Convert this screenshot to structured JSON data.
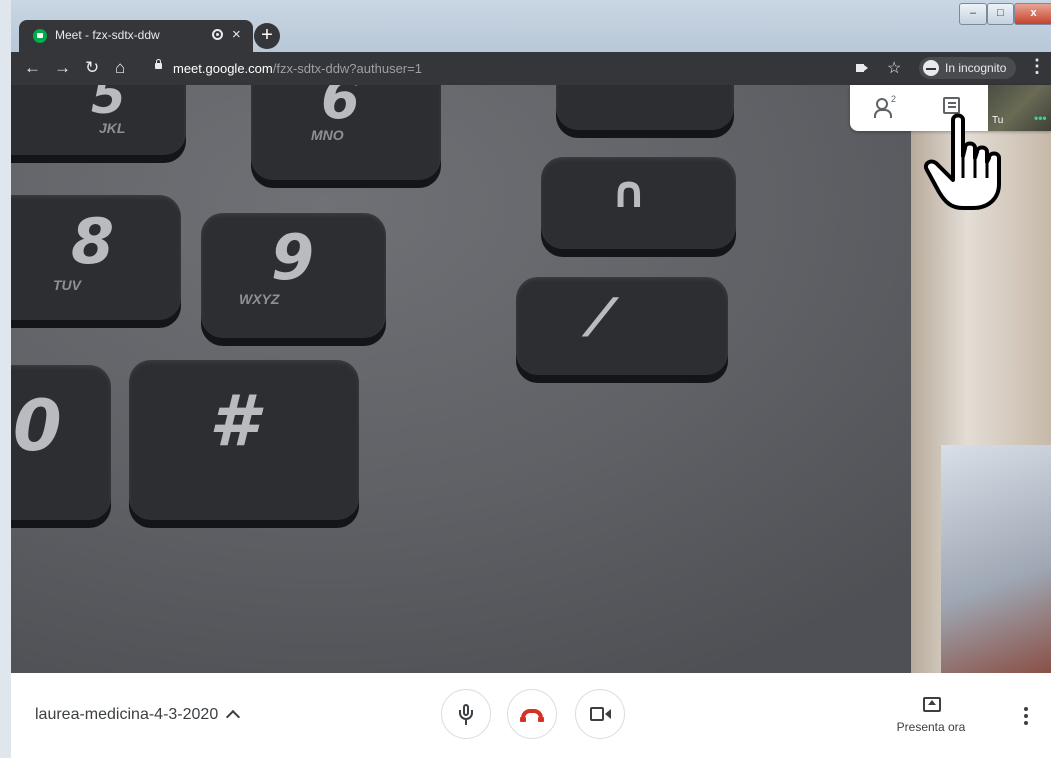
{
  "browser": {
    "tab_title": "Meet - fzx-sdtx-ddw",
    "tab_close": "×",
    "new_tab": "+",
    "url_host": "meet.google.com",
    "url_path": "/fzx-sdtx-ddw?authuser=1",
    "incognito_label": "In incognito",
    "nav": {
      "back": "←",
      "forward": "→",
      "reload": "↻",
      "home": "⌂",
      "star": "☆",
      "menu": "⋮"
    },
    "window_controls": {
      "minimize": "–",
      "maximize": "□",
      "close": "x"
    }
  },
  "meet": {
    "participants_count": "2",
    "self_label": "Tu",
    "self_menu": "•••",
    "meeting_name": "laurea-medicina-4-3-2020",
    "present_label": "Presenta ora"
  },
  "video_keys": [
    {
      "glyph": "5",
      "sub": "JKL"
    },
    {
      "glyph": "6",
      "sub": "MNO"
    },
    {
      "glyph": "8",
      "sub": "TUV"
    },
    {
      "glyph": "9",
      "sub": "WXYZ"
    },
    {
      "glyph": "#",
      "sub": ""
    },
    {
      "glyph": "0",
      "sub": ""
    }
  ],
  "icons": {
    "participants": "participants-icon",
    "chat": "chat-icon",
    "mic": "microphone-icon",
    "hangup": "hangup-icon",
    "camera": "camera-icon",
    "present": "present-screen-icon",
    "more": "more-vert-icon",
    "cursor": "hand-cursor-icon"
  }
}
